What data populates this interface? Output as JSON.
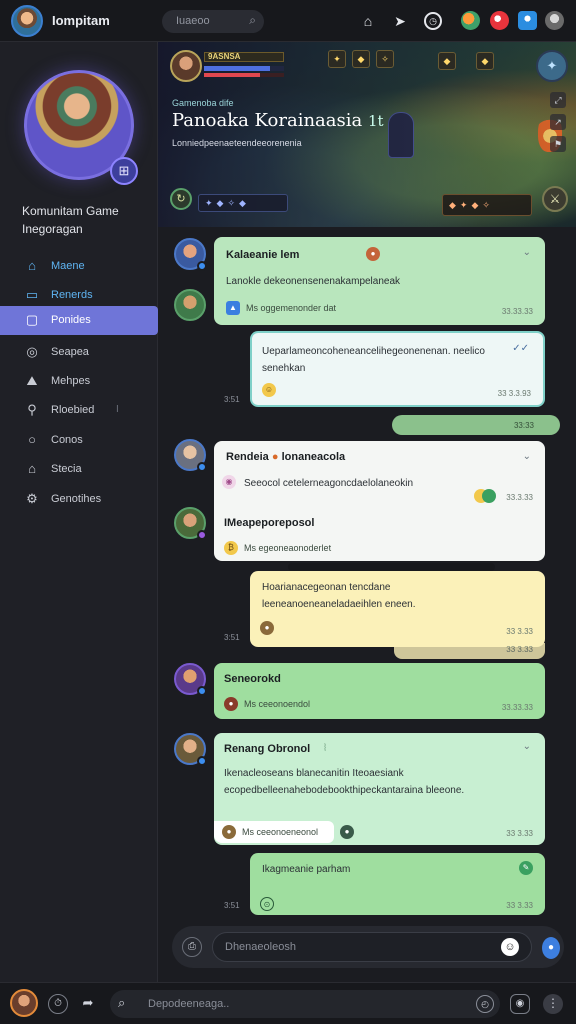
{
  "app": {
    "title": "Iompitam",
    "search_placeholder": "Iuaeoo"
  },
  "top_icons": [
    "home-icon",
    "bolt-icon",
    "clock-icon",
    "game-badge-icon",
    "notification-icon",
    "user-badge-icon",
    "profile-icon"
  ],
  "colors": {
    "accent": "#6f75d8",
    "link": "#5fb4f2",
    "bubble_green": "#b9e6bd",
    "bubble_yellow": "#fbf1b9"
  },
  "sidebar": {
    "community_name": "Komunitam Game Inegoragan",
    "nav": [
      {
        "label": "Maene",
        "icon": "home-icon"
      },
      {
        "label": "Renerds",
        "icon": "board-icon"
      },
      {
        "label": "Ponides",
        "icon": "chat-icon"
      },
      {
        "label": "Seapea",
        "icon": "target-icon"
      },
      {
        "label": "Mehpes",
        "icon": "map-icon"
      },
      {
        "label": "Rloebied",
        "icon": "link-icon",
        "extra": "I"
      },
      {
        "label": "Conos",
        "icon": "circle-icon"
      },
      {
        "label": "Stecia",
        "icon": "store-icon"
      },
      {
        "label": "Genotihes",
        "icon": "gear-icon"
      }
    ]
  },
  "banner": {
    "subtitle": "Gamenoba dife",
    "title": "Panoaka Korainaasia",
    "title_suffix": "1t",
    "description": "Lonniedpeenaeteendeeorenenia",
    "hud_level": "9ASNSA",
    "hud_mana_percent": 82,
    "hud_health_percent": 70,
    "hud_slots": [
      "✦",
      "◆",
      "✧",
      "◆",
      "◆"
    ]
  },
  "messages": [
    {
      "name": "Kalaeanie lem",
      "text": "Lanokle dekeonensenenakampelaneak",
      "meta": "Ms oggemenonder dat",
      "time": "33.33.33"
    },
    {
      "text": "Ueparlameoncoheneancelihegeonenenan. neelico senehkan",
      "time": "33 3.3.93",
      "side_time": "3:51"
    },
    {
      "time": "33:33",
      "reply": "reply-bar"
    },
    {
      "name": "Rendeia",
      "name_suffix": "lonaneacola",
      "text": "Seeocol cetelerneagoncdaelolaneokin",
      "time": "33.3.33"
    },
    {
      "name": "IMeapeporeposol",
      "meta": "Ms egeoneaonoderlet"
    },
    {
      "text": "Hoarianacegeonan tencdane leeneanoeneaneladaeihlen eneen.",
      "time": "33 3.33",
      "side_time": "3:51"
    },
    {
      "name": "Seneorokd",
      "meta": "Ms ceeonoendol",
      "time": "33.33.33"
    },
    {
      "name": "Renang Obronol",
      "text": "Ikenacleoseans blanecanitin Iteoaesiank ecopedbelleenahebodebookthipeckantaraina bleeone.",
      "meta": "Ms ceeonoeneonol",
      "time": "33 3.33"
    },
    {
      "text": "Ikagmeanie parham",
      "time": "33 3.33",
      "side_time": "3:51"
    }
  ],
  "composer": {
    "placeholder": "Dhenaeoleosh"
  },
  "bottombar": {
    "search_placeholder": "Depodeeneaga.."
  }
}
